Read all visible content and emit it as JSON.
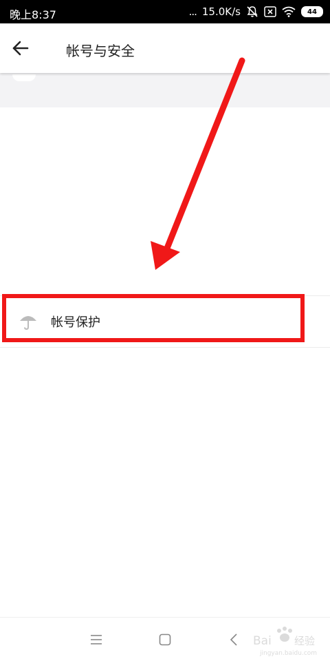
{
  "status_bar": {
    "time": "晚上8:37",
    "dots": "...",
    "speed": "15.0K/s",
    "battery": "44"
  },
  "header": {
    "title": "帐号与安全",
    "back_icon": "arrow-left-icon"
  },
  "menu": {
    "items": [
      {
        "label": "帐号保护",
        "icon": "umbrella-icon"
      }
    ]
  },
  "navigation": {
    "menu_icon": "menu-icon",
    "home_icon": "square-icon",
    "back_icon": "chevron-left-icon"
  },
  "colors": {
    "status_bar": "#000000",
    "annotation_red": "#f01818",
    "band": "#f3f3f5",
    "text": "#222222",
    "icon_gray": "#bbbbbb"
  }
}
